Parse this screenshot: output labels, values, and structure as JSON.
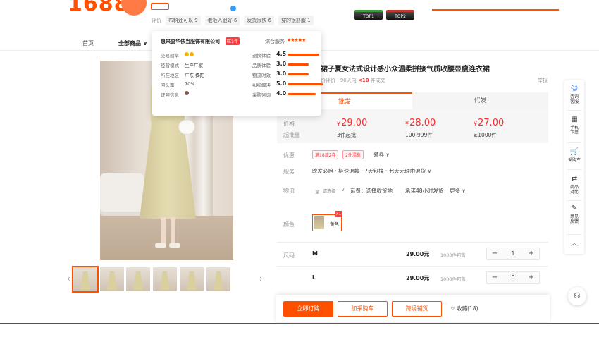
{
  "header": {
    "logo_text": "1688",
    "rating_label": "评价",
    "rating_chips": [
      "布料还可以 9",
      "老板人很好 6",
      "发货很快 6",
      "穿的很舒服 1"
    ],
    "badges": [
      "TOP1",
      "TOP2"
    ]
  },
  "nav": {
    "home": "首页",
    "all_products": "全部商品 ∨"
  },
  "popover": {
    "company": "惠来县华依当服饰有限公司",
    "company_tag": "旺1年",
    "overall_label": "综合服务",
    "overall_stars": "★★★★★",
    "left_rows": [
      {
        "label": "交易勋章",
        "value": ""
      },
      {
        "label": "经营模式",
        "value": "生产厂家"
      },
      {
        "label": "所在地区",
        "value": "广东 揭阳"
      },
      {
        "label": "回头率",
        "value": "70%"
      },
      {
        "label": "证照信息",
        "value": ""
      }
    ],
    "right_rows": [
      {
        "label": "退换体验",
        "score": "4.5",
        "fraction": 0.9
      },
      {
        "label": "品质体验",
        "score": "3.0",
        "fraction": 0.6
      },
      {
        "label": "物流时效",
        "score": "3.0",
        "fraction": 0.6
      },
      {
        "label": "纠纷解决",
        "score": "5.0",
        "fraction": 1.0
      },
      {
        "label": "采购咨询",
        "score": "4.0",
        "fraction": 0.8
      }
    ]
  },
  "product": {
    "title": "裙子夏女法式设计感小众温柔拼接气质收腰显瘦连衣裙",
    "eval_prefix": "价评价 | 90天内",
    "eval_count": "<10",
    "eval_suffix": "件成交",
    "report": "举报"
  },
  "tabs": {
    "wholesale": "批发",
    "dropship": "代发"
  },
  "pricing": {
    "price_label": "价格",
    "moq_label": "起批量",
    "currency": "¥",
    "tiers": [
      {
        "price": "29.00",
        "qty": "3件起批"
      },
      {
        "price": "28.00",
        "qty": "100-999件"
      },
      {
        "price": "27.00",
        "qty": "≥1000件"
      }
    ]
  },
  "offers": {
    "label": "优惠",
    "coupons": [
      "满18减2券",
      "2件混批"
    ],
    "get_coupon": "领券 ∨"
  },
  "service": {
    "label": "服务",
    "text": "晚发必赔 · 极速退款 · 7天包换 · 七天无理由退货 ∨"
  },
  "logistics": {
    "label": "物流",
    "to": "至",
    "select": "请选择",
    "fee": "运费：选择收货地",
    "promise": "承诺48小时发货",
    "more": "更多 ∨"
  },
  "color": {
    "label": "颜色",
    "option": "黄色",
    "count": "x1"
  },
  "sizes": {
    "label": "尺码",
    "rows": [
      {
        "name": "M",
        "price": "29.00元",
        "stock": "1000件可售",
        "qty": "1"
      },
      {
        "name": "L",
        "price": "29.00元",
        "stock": "1000件可售",
        "qty": "0"
      }
    ]
  },
  "actions": {
    "order": "立即订购",
    "cart": "加采购车",
    "stock": "跨境铺货",
    "favorite": "☆ 收藏(18)"
  },
  "sidebar": {
    "items": [
      {
        "icon": "chat-icon",
        "glyph": "☺",
        "label1": "咨询",
        "label2": "客服"
      },
      {
        "icon": "qrcode-icon",
        "glyph": "▦",
        "label1": "手机",
        "label2": "下单"
      },
      {
        "icon": "cart-icon",
        "glyph": "🛒",
        "label1": "采购车",
        "label2": ""
      },
      {
        "icon": "compare-icon",
        "glyph": "⇄",
        "label1": "商品",
        "label2": "对比"
      },
      {
        "icon": "feedback-icon",
        "glyph": "✎",
        "label1": "意见",
        "label2": "反馈"
      }
    ],
    "top_glyph": "︿"
  },
  "colors": {
    "accent": "#ff5000",
    "price_red": "#ff2a2a"
  }
}
